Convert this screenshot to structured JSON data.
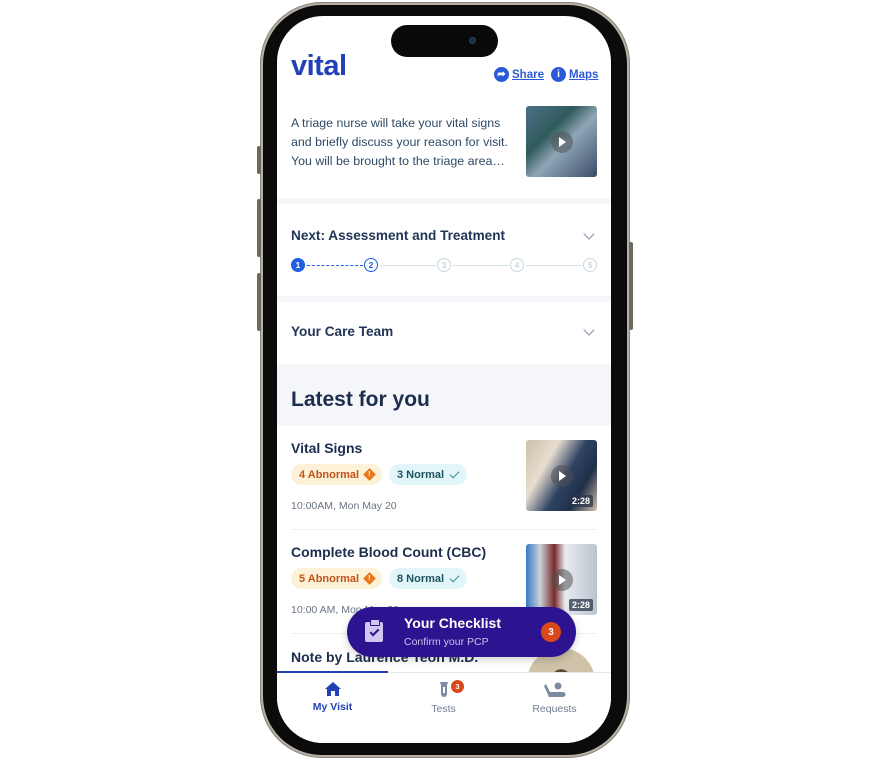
{
  "app": {
    "logo": "vital"
  },
  "header": {
    "share_label": "Share",
    "maps_label": "Maps",
    "share_icon": "share-icon",
    "maps_icon": "info-icon"
  },
  "intro": {
    "text": "A triage nurse will take your vital signs and briefly discuss your reason for visit. You will be brought to the triage area…",
    "thumbnail": "triage-nurse-video"
  },
  "next_step": {
    "title": "Next: Assessment and Treatment",
    "steps": [
      {
        "label": "1",
        "state": "done"
      },
      {
        "label": "2",
        "state": "current"
      },
      {
        "label": "3",
        "state": "todo"
      },
      {
        "label": "4",
        "state": "todo"
      },
      {
        "label": "5",
        "state": "todo"
      }
    ]
  },
  "care_team": {
    "title": "Your Care Team"
  },
  "latest": {
    "title": "Latest for you",
    "items": [
      {
        "title": "Vital Signs",
        "abnormal": "4 Abnormal",
        "normal": "3 Normal",
        "time": "10:00AM, Mon May 20",
        "duration": "2:28"
      },
      {
        "title": "Complete Blood Count (CBC)",
        "abnormal": "5 Abnormal",
        "normal": "8 Normal",
        "time": "10:00 AM, Mon May 20",
        "duration": "2:28"
      },
      {
        "title": "Note by Laurence Teoh M.D."
      }
    ]
  },
  "checklist": {
    "title": "Your Checklist",
    "subtitle": "Confirm your PCP",
    "count": "3"
  },
  "tabbar": {
    "tabs": [
      {
        "label": "My Visit",
        "icon": "home-icon",
        "active": true
      },
      {
        "label": "Tests",
        "icon": "test-tube-icon",
        "badge": "3"
      },
      {
        "label": "Requests",
        "icon": "request-icon"
      }
    ]
  },
  "colors": {
    "brand": "#2340b6",
    "link": "#2a5ad8",
    "checklist_bg": "#2d1390",
    "badge": "#d9481a",
    "abnormal_bg": "#fdf1d7",
    "abnormal_text": "#c2521a",
    "normal_bg": "#e2f6fa"
  }
}
